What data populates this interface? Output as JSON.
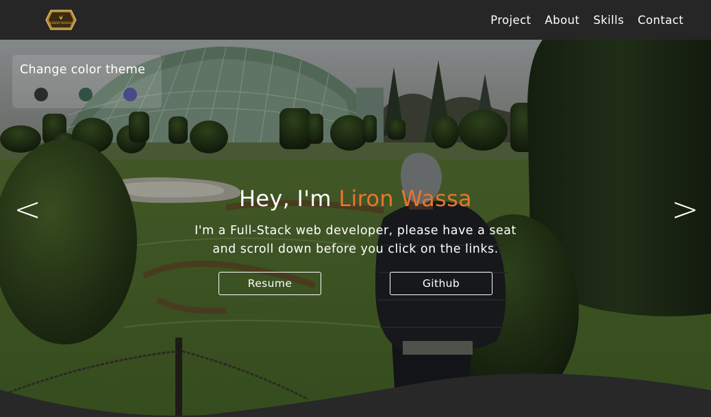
{
  "logo": {
    "text": "LIRON WASSA"
  },
  "nav": {
    "items": [
      {
        "label": "Project"
      },
      {
        "label": "About"
      },
      {
        "label": "Skills"
      },
      {
        "label": "Contact"
      }
    ]
  },
  "theme": {
    "title": "Change color theme",
    "swatches": [
      {
        "color": "#2b2b2b"
      },
      {
        "color": "#2f5242"
      },
      {
        "color": "#4a4a86"
      }
    ]
  },
  "hero": {
    "greeting": "Hey, I'm ",
    "name": "Liron Wassa",
    "accent_color": "#e8752c",
    "sub_line1": "I'm a Full-Stack web developer, please have a seat",
    "sub_line2": "and scroll down before you click on the links.",
    "prev": "<",
    "next": ">"
  },
  "buttons": {
    "resume": "Resume",
    "github": "Github"
  }
}
